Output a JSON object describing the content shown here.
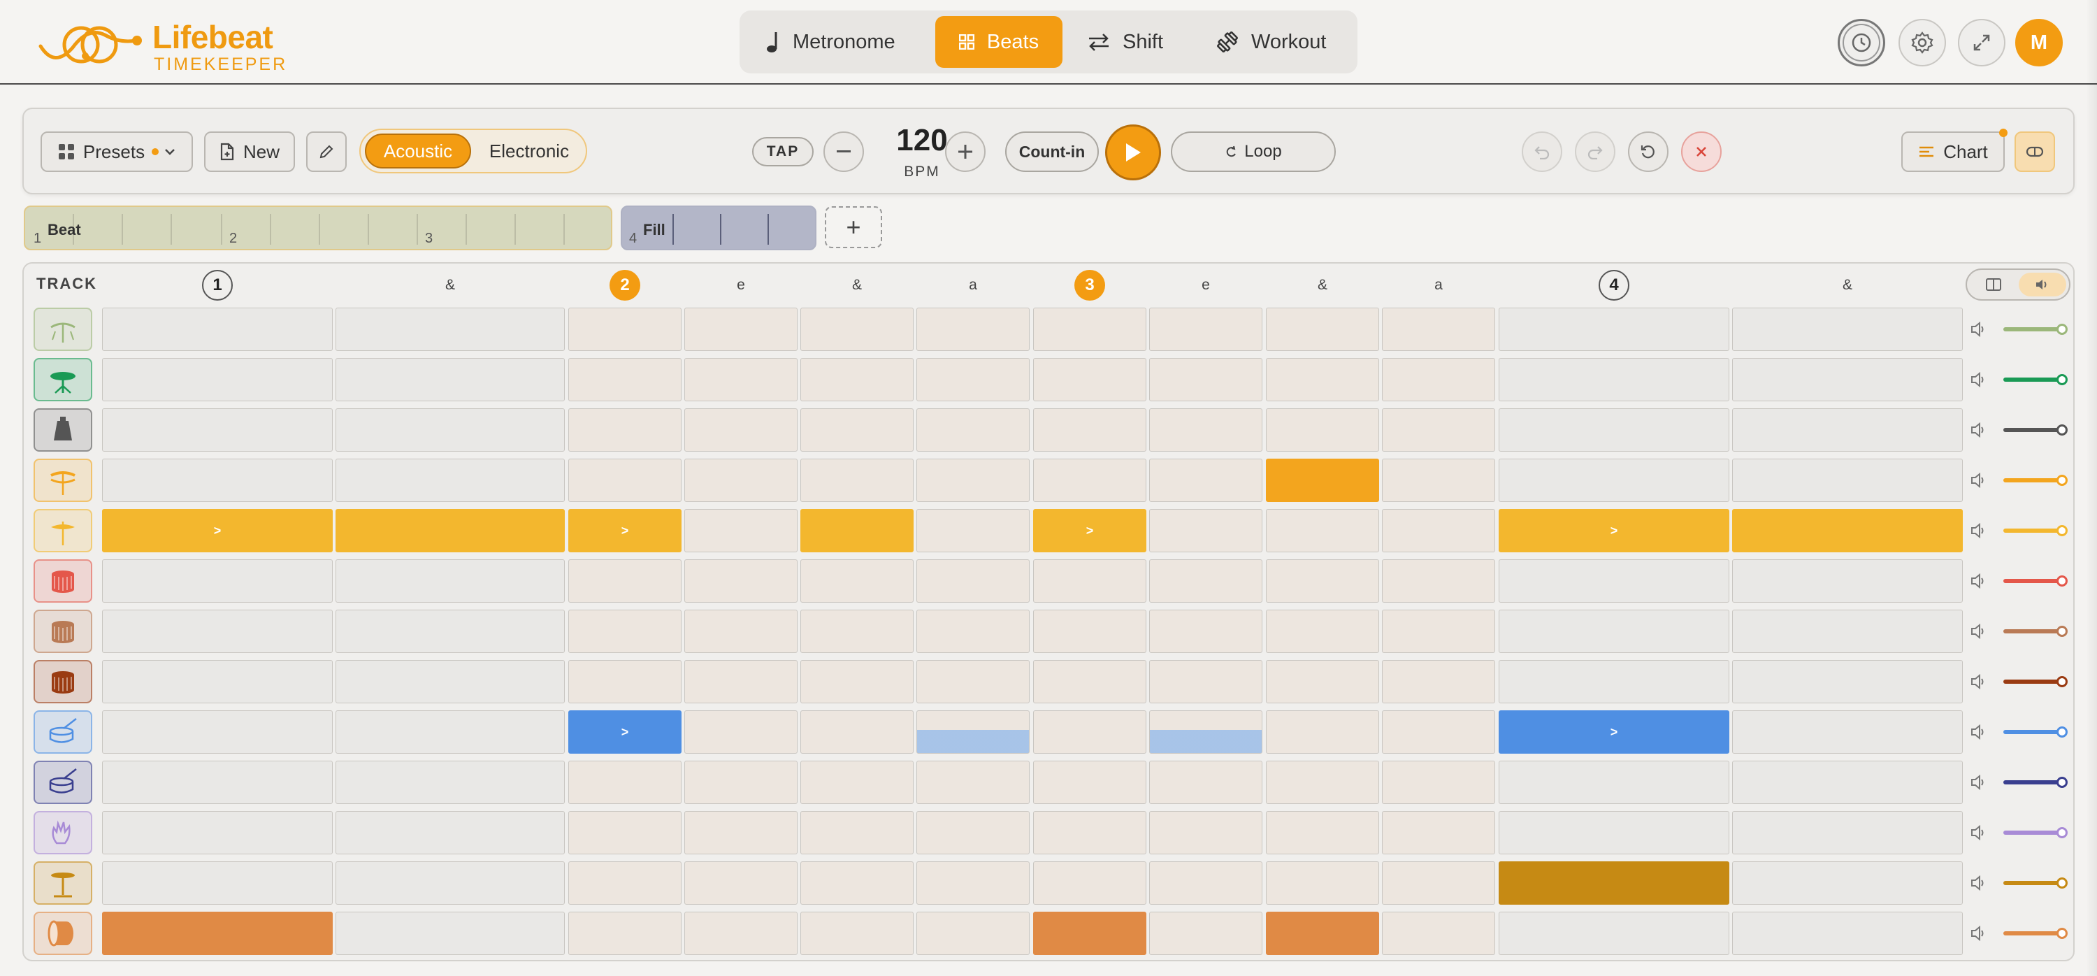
{
  "app": {
    "name": "Lifebeat",
    "tagline": "TIMEKEEPER",
    "avatar_initial": "M",
    "accent": "#f39c12"
  },
  "nav": {
    "tabs": [
      {
        "label": "Metronome",
        "icon": "quarter-note-icon",
        "active": false
      },
      {
        "label": "Beats",
        "icon": "grid-icon",
        "active": true
      },
      {
        "label": "Shift",
        "icon": "swap-arrows-icon",
        "active": false
      },
      {
        "label": "Workout",
        "icon": "dumbbell-icon",
        "active": false
      }
    ],
    "header_icons": [
      "clock-icon",
      "gear-icon",
      "expand-icon",
      "avatar"
    ]
  },
  "toolbar": {
    "presets_label": "Presets",
    "new_label": "New",
    "kit_options": [
      "Acoustic",
      "Electronic"
    ],
    "kit_selected": "Acoustic",
    "tap_label": "TAP",
    "bpm": "120",
    "bpm_unit": "BPM",
    "count_in_label": "Count-in",
    "loop_label": "Loop",
    "chart_label": "Chart"
  },
  "sections": [
    {
      "label": "Beat",
      "bar_start": "1",
      "bar_numbers": [
        "1",
        "2",
        "3"
      ]
    },
    {
      "label": "Fill",
      "bar_start": "4"
    }
  ],
  "add_section_label": "+",
  "grid": {
    "track_header": "TRACK",
    "beat_labels": [
      "1",
      "&",
      "2",
      "e",
      "&",
      "a",
      "3",
      "e",
      "&",
      "a",
      "4",
      "&"
    ],
    "accent_mark": ">",
    "tracks": [
      {
        "name": "china-cymbal",
        "icon": "china-cymbal-icon",
        "color": "#9bb77a",
        "cells": [
          0,
          0,
          0,
          0,
          0,
          0,
          0,
          0,
          0,
          0,
          0,
          0
        ]
      },
      {
        "name": "ride-cymbal",
        "icon": "ride-cymbal-icon",
        "color": "#1a9a55",
        "cells": [
          0,
          0,
          0,
          0,
          0,
          0,
          0,
          0,
          0,
          0,
          0,
          0
        ]
      },
      {
        "name": "cowbell",
        "icon": "cowbell-icon",
        "color": "#555555",
        "cells": [
          0,
          0,
          0,
          0,
          0,
          0,
          0,
          0,
          0,
          0,
          0,
          0
        ]
      },
      {
        "name": "open-hihat",
        "icon": "open-hihat-icon",
        "color": "#f3a51e",
        "cells": [
          0,
          0,
          0,
          0,
          0,
          0,
          0,
          0,
          1,
          0,
          0,
          0
        ]
      },
      {
        "name": "closed-hihat",
        "icon": "closed-hihat-icon",
        "color": "#f3b72e",
        "cells": [
          2,
          1,
          2,
          0,
          1,
          0,
          2,
          0,
          0,
          0,
          2,
          1
        ]
      },
      {
        "name": "high-tom",
        "icon": "high-tom-icon",
        "color": "#e4574a",
        "cells": [
          0,
          0,
          0,
          0,
          0,
          0,
          0,
          0,
          0,
          0,
          0,
          0
        ]
      },
      {
        "name": "mid-tom",
        "icon": "mid-tom-icon",
        "color": "#b97a55",
        "cells": [
          0,
          0,
          0,
          0,
          0,
          0,
          0,
          0,
          0,
          0,
          0,
          0
        ]
      },
      {
        "name": "floor-tom",
        "icon": "floor-tom-icon",
        "color": "#9a3b12",
        "cells": [
          0,
          0,
          0,
          0,
          0,
          0,
          0,
          0,
          0,
          0,
          0,
          0
        ]
      },
      {
        "name": "snare",
        "icon": "snare-icon",
        "color": "#4f8fe3",
        "cells": [
          0,
          0,
          2,
          0,
          0,
          3,
          0,
          3,
          0,
          0,
          2,
          0
        ]
      },
      {
        "name": "rimshot",
        "icon": "rimshot-icon",
        "color": "#3a3f8f",
        "cells": [
          0,
          0,
          0,
          0,
          0,
          0,
          0,
          0,
          0,
          0,
          0,
          0
        ]
      },
      {
        "name": "clap",
        "icon": "clap-icon",
        "color": "#a88bd6",
        "cells": [
          0,
          0,
          0,
          0,
          0,
          0,
          0,
          0,
          0,
          0,
          0,
          0
        ]
      },
      {
        "name": "pedal-hihat",
        "icon": "pedal-hihat-icon",
        "color": "#c68a14",
        "cells": [
          0,
          0,
          0,
          0,
          0,
          0,
          0,
          0,
          0,
          0,
          1,
          0
        ]
      },
      {
        "name": "kick",
        "icon": "kick-drum-icon",
        "color": "#e08a45",
        "cells": [
          1,
          0,
          0,
          0,
          0,
          0,
          1,
          0,
          1,
          0,
          0,
          0
        ]
      }
    ]
  }
}
